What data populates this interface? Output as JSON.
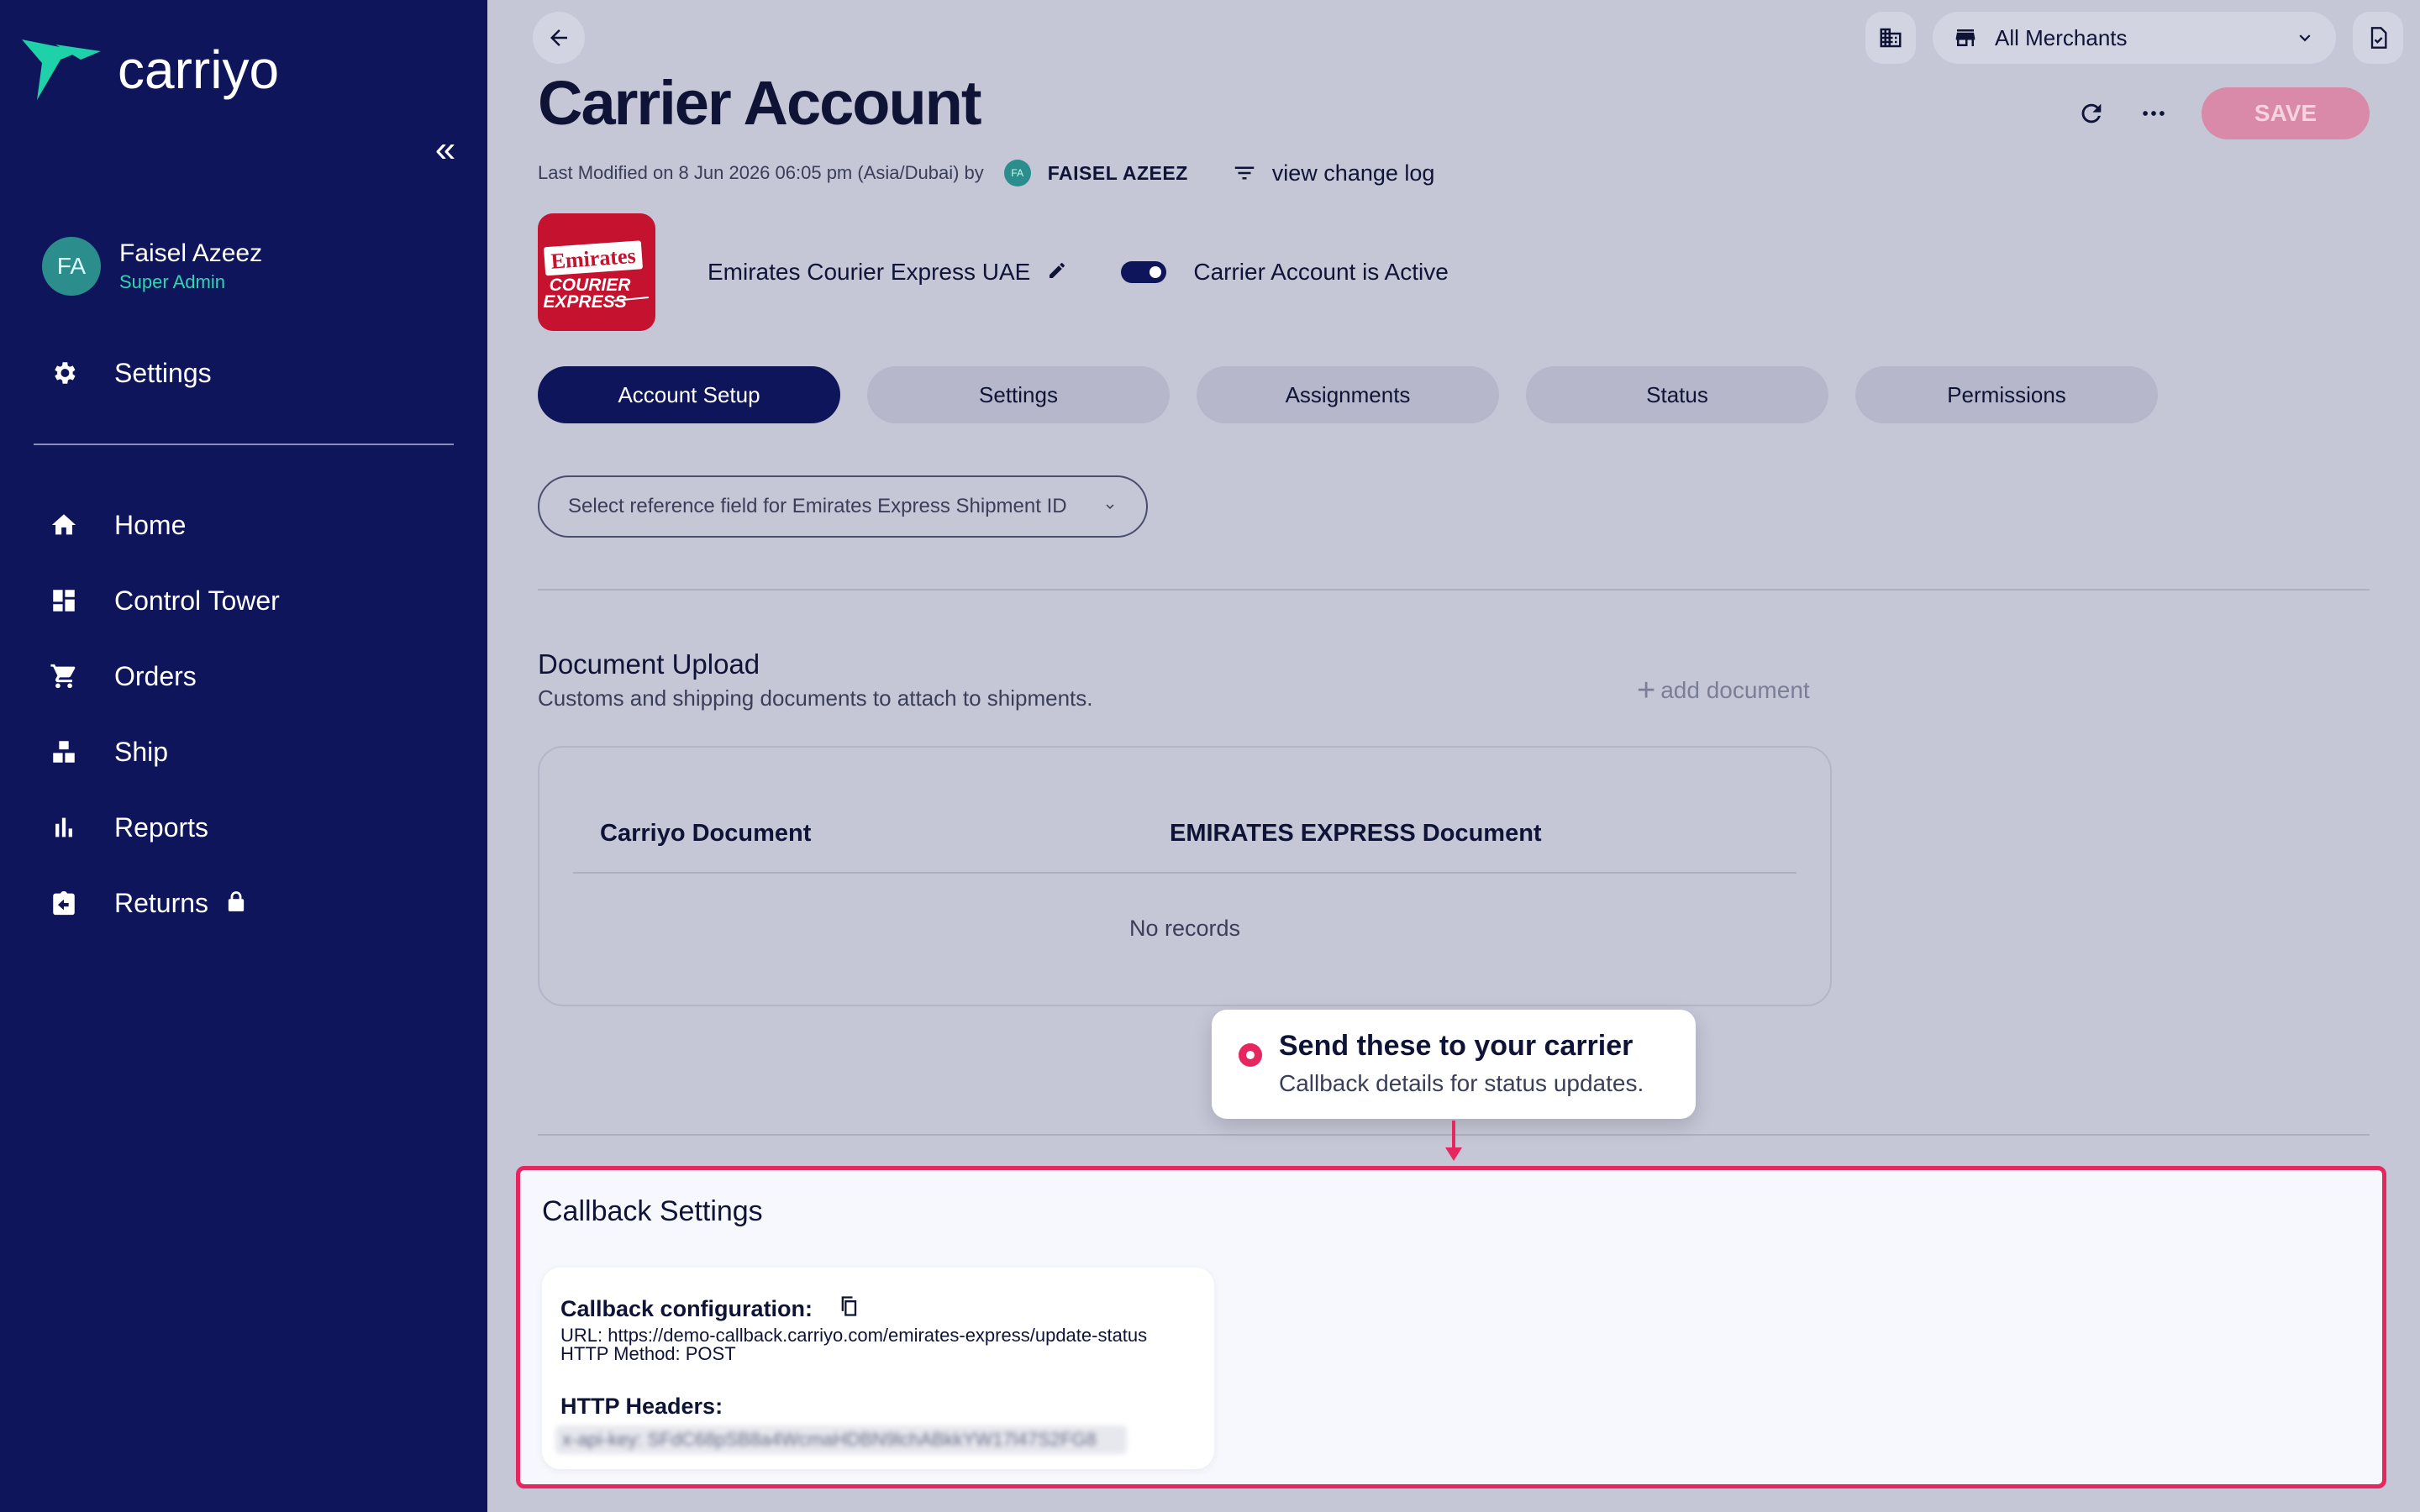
{
  "sidebar": {
    "brand": "carriyo",
    "user": {
      "initials": "FA",
      "name": "Faisel Azeez",
      "role": "Super Admin"
    },
    "settings_label": "Settings",
    "items": [
      {
        "label": "Home",
        "icon": "home-icon"
      },
      {
        "label": "Control Tower",
        "icon": "dashboard-icon"
      },
      {
        "label": "Orders",
        "icon": "cart-icon"
      },
      {
        "label": "Ship",
        "icon": "boxes-icon"
      },
      {
        "label": "Reports",
        "icon": "bar-chart-icon"
      },
      {
        "label": "Returns",
        "icon": "return-box-icon",
        "locked": true
      }
    ]
  },
  "topbar": {
    "merchant": "All Merchants"
  },
  "header": {
    "title": "Carrier Account",
    "save_label": "SAVE",
    "meta_prefix": "Last Modified on 8 Jun 2026 06:05 pm (Asia/Dubai) by",
    "meta_initials": "FA",
    "meta_user": "FAISEL AZEEZ",
    "changelog_label": "view change log"
  },
  "carrier": {
    "name": "Emirates Courier Express UAE",
    "logo_text_1": "Emirates",
    "logo_text_2": "COURIER",
    "logo_text_3": "EXPRESS",
    "active_label": "Carrier Account is Active",
    "active": true
  },
  "tabs": [
    {
      "label": "Account Setup",
      "active": true
    },
    {
      "label": "Settings",
      "active": false
    },
    {
      "label": "Assignments",
      "active": false
    },
    {
      "label": "Status",
      "active": false
    },
    {
      "label": "Permissions",
      "active": false
    }
  ],
  "reference_select": {
    "placeholder": "Select reference field for Emirates Express Shipment ID"
  },
  "documents": {
    "title": "Document Upload",
    "subtitle": "Customs and shipping documents to attach to shipments.",
    "add_label": "add document",
    "columns": [
      "Carriyo Document",
      "EMIRATES EXPRESS Document"
    ],
    "empty_text": "No records"
  },
  "callout": {
    "title": "Send these to your carrier",
    "subtitle": "Callback details for status updates."
  },
  "callback": {
    "title": "Callback Settings",
    "config_label": "Callback configuration:",
    "url_line": "URL: https://demo-callback.carriyo.com/emirates-express/update-status",
    "method_line": "HTTP Method: POST",
    "headers_label": "HTTP Headers:",
    "headers_value": "x-api-key: SFdC68pSB8a4WcmaHDBN9lchABkkYW17l47S2FG8"
  },
  "colors": {
    "sidebar_bg": "#0f155a",
    "accent": "#e5265f",
    "save_btn": "#d88aa8",
    "carrier_red": "#c4122f"
  }
}
